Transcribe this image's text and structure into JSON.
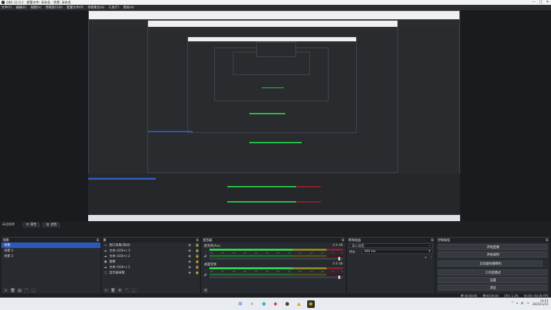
{
  "window": {
    "title": "OBS 31.0.2 - 配置文件: 未命名 - 场景: 未命名",
    "min": "—",
    "max": "□",
    "close": "✕"
  },
  "menu": [
    "文件(F)",
    "编辑(E)",
    "视图(V)",
    "停靠窗口(D)",
    "配置文件(P)",
    "场景集合(S)",
    "工具(T)",
    "帮助(H)"
  ],
  "tabs": {
    "scene_name": "未选择源",
    "properties": "属性",
    "filters": "滤镜"
  },
  "scenes": {
    "title": "场景",
    "items": [
      "场景",
      "场景 2",
      "场景 3"
    ],
    "selected": 0
  },
  "sources": {
    "title": "源",
    "items": [
      {
        "icon": "window-capture-icon",
        "glyph": "▭",
        "name": "窗口采集(测试)"
      },
      {
        "icon": "text-icon",
        "glyph": "☁",
        "name": "文本 (GDI+) 3"
      },
      {
        "icon": "text-icon",
        "glyph": "☁",
        "name": "文本 (GDI+) 2"
      },
      {
        "icon": "image-icon",
        "glyph": "▣",
        "name": "图像"
      },
      {
        "icon": "text-icon",
        "glyph": "☁",
        "name": "文本 (GDI+) 1"
      },
      {
        "icon": "display-capture-icon",
        "glyph": "▢",
        "name": "显示器采集"
      }
    ]
  },
  "mixer": {
    "title": "混音器",
    "channels": [
      {
        "name": "麦克风/Aux",
        "db": "0.0 dB"
      },
      {
        "name": "桌面音频",
        "db": "0.0 dB"
      }
    ],
    "ticks": [
      "-60",
      "-55",
      "-50",
      "-45",
      "-40",
      "-35",
      "-30",
      "-25",
      "-20",
      "-15",
      "-10",
      "-5",
      "0"
    ]
  },
  "transitions": {
    "title": "转场动画",
    "type": "淡入淡出",
    "duration_label": "时长",
    "duration": "300 ms"
  },
  "controls": {
    "title": "控制按钮",
    "buttons": [
      "开始直播",
      "开始录制",
      "启动虚拟摄像机",
      "工作室模式",
      "设置",
      "退出"
    ]
  },
  "status": {
    "rec_time": "00:00:00",
    "stream_time": "00:00:00",
    "cpu": "CPU: 1.3%",
    "fps": "60.00 / 60.00 FPS"
  },
  "clock": {
    "time": "14:22",
    "date": "2025/11/15"
  }
}
